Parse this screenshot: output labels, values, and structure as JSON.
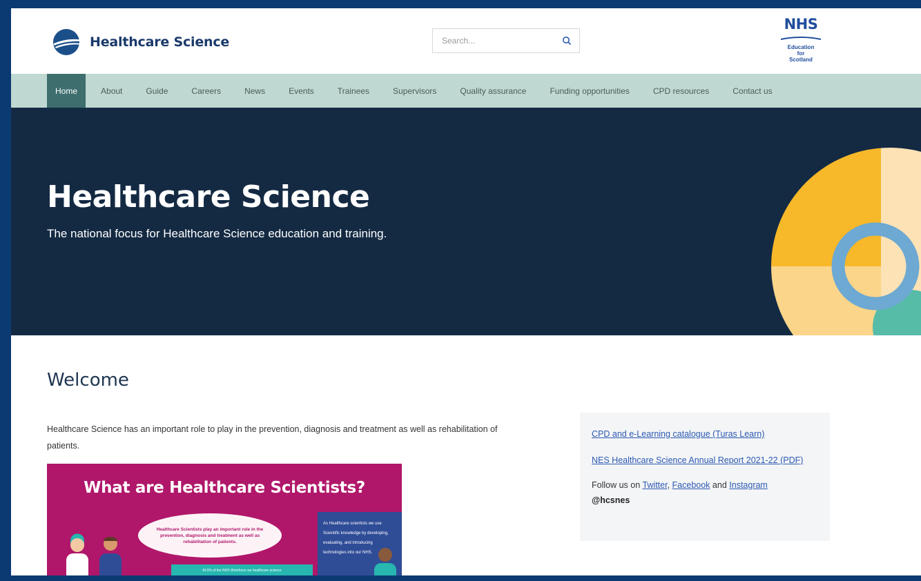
{
  "header": {
    "logo_text": "Healthcare Science",
    "search_placeholder": "Search...",
    "nhs": {
      "mark": "NHS",
      "sub_lines": [
        "Education",
        "for",
        "Scotland"
      ]
    }
  },
  "nav": {
    "items": [
      {
        "label": "Home",
        "active": true
      },
      {
        "label": "About"
      },
      {
        "label": "Guide"
      },
      {
        "label": "Careers"
      },
      {
        "label": "News"
      },
      {
        "label": "Events"
      },
      {
        "label": "Trainees"
      },
      {
        "label": "Supervisors"
      },
      {
        "label": "Quality assurance"
      },
      {
        "label": "Funding opportunities"
      },
      {
        "label": "CPD resources"
      },
      {
        "label": "Contact us"
      }
    ]
  },
  "hero": {
    "title": "Healthcare Science",
    "subtitle": "The national focus for Healthcare Science education and training."
  },
  "main": {
    "heading": "Welcome",
    "intro": "Healthcare Science has an important role to play in the prevention, diagnosis and treatment as well as rehabilitation of patients.",
    "promo": {
      "title": "What are Healthcare Scientists?",
      "ellipse_text": "Healthcare Scientists play an important role in the prevention, diagnosis and treatment as well as rehabilitation of patients.",
      "box_text": "As Healthcare scientists we use Scientific knowledge by developing, evaluating, and introducing technologies into our NHS.",
      "band_text": "At 5% of the NHS Workforce we healthcare science"
    }
  },
  "sidebar": {
    "link1": "CPD and e-Learning catalogue (Turas Learn)",
    "link2": "NES Healthcare Science Annual Report 2021-22 (PDF)",
    "follow_prefix": "Follow us on",
    "twitter": "Twitter",
    "comma": ",",
    "facebook": "Facebook",
    "and": "and",
    "instagram": "Instagram",
    "handle": "@hcsnes"
  },
  "colors": {
    "frame": "#0b3a72",
    "nav_bg": "#bfd8d2",
    "nav_active": "#3e6e6e",
    "hero_bg": "#142a43",
    "promo_bg": "#b0176a",
    "link": "#2d59b3"
  }
}
